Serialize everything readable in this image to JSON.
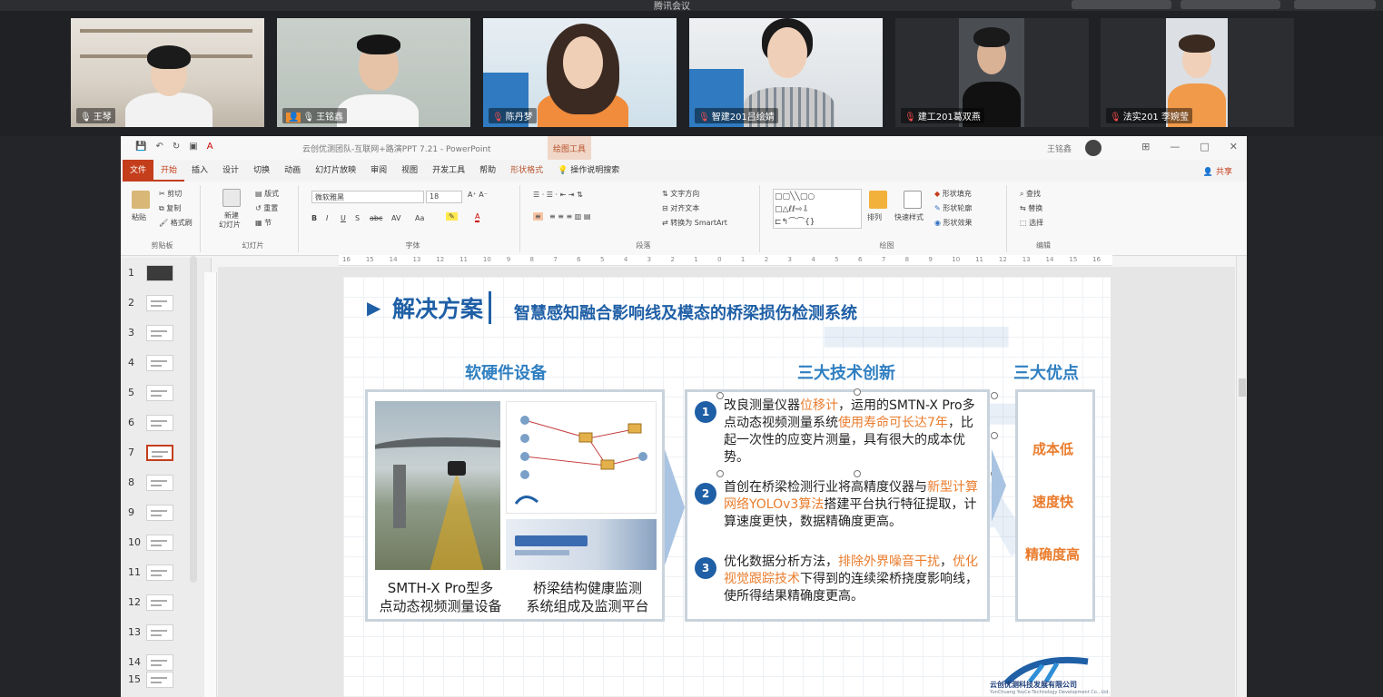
{
  "meeting": {
    "title": "腾讯会议",
    "participants": [
      {
        "name": "王琴",
        "muted": false,
        "active": false
      },
      {
        "name": "王铭鑫",
        "muted": false,
        "active": true
      },
      {
        "name": "陈丹梦",
        "muted": true,
        "active": false
      },
      {
        "name": "智建201吕绘婧",
        "muted": true,
        "active": false
      },
      {
        "name": "建工201葛双燕",
        "muted": true,
        "active": false
      },
      {
        "name": "法实201 李婉莹",
        "muted": true,
        "active": false
      }
    ]
  },
  "powerpoint": {
    "doc_title": "云创优测团队-互联网+路演PPT 7.21 - PowerPoint",
    "context_tab": "绘图工具",
    "user": "王铭鑫",
    "window_buttons": [
      "⊞",
      "—",
      "□",
      "✕"
    ],
    "tabs": [
      "文件",
      "开始",
      "插入",
      "设计",
      "切换",
      "动画",
      "幻灯片放映",
      "审阅",
      "视图",
      "开发工具",
      "帮助",
      "形状格式"
    ],
    "tell_me": "操作说明搜索",
    "share": "共享",
    "ribbon": {
      "clipboard": {
        "label": "剪贴板",
        "paste": "粘贴",
        "cut": "剪切",
        "copy": "复制",
        "format_painter": "格式刷"
      },
      "slides": {
        "label": "幻灯片",
        "new_slide": "新建",
        "new_slide_2": "幻灯片",
        "layout": "版式",
        "reset": "重置",
        "section": "节"
      },
      "font": {
        "label": "字体",
        "font_name": "微软雅黑",
        "font_size": "18",
        "buttons": [
          "B",
          "I",
          "U",
          "S",
          "abc",
          "AV",
          "Aa"
        ]
      },
      "paragraph": {
        "label": "段落",
        "text_direction": "文字方向",
        "align_text": "对齐文本",
        "smartart": "转换为 SmartArt"
      },
      "drawing": {
        "label": "绘图",
        "arrange": "排列",
        "quick_styles": "快速样式",
        "fill": "形状填充",
        "outline": "形状轮廓",
        "effects": "形状效果"
      },
      "editing": {
        "label": "编辑",
        "find": "查找",
        "replace": "替换",
        "select": "选择"
      }
    },
    "ruler_ticks": [
      "16",
      "15",
      "14",
      "13",
      "12",
      "11",
      "10",
      "9",
      "8",
      "7",
      "6",
      "5",
      "4",
      "3",
      "2",
      "1",
      "0",
      "1",
      "2",
      "3",
      "4",
      "5",
      "6",
      "7",
      "8",
      "9",
      "10",
      "11",
      "12",
      "13",
      "14",
      "15",
      "16"
    ],
    "thumbnails": [
      "1",
      "2",
      "3",
      "4",
      "5",
      "6",
      "7",
      "8",
      "9",
      "10",
      "11",
      "12",
      "13",
      "14",
      "15"
    ],
    "selected_slide": 7
  },
  "slide": {
    "title": "解决方案",
    "subtitle": "智慧感知融合影响线及模态的桥梁损伤检测系统",
    "section_hardware": "软硬件设备",
    "section_innovation": "三大技术创新",
    "section_advantages": "三大优点",
    "caption_left_1": "SMTH-X Pro型多",
    "caption_left_2": "点动态视频测量设备",
    "caption_right_1": "桥梁结构健康监测",
    "caption_right_2": "系统组成及监测平台",
    "items": [
      {
        "num": "1",
        "p1": "改良测量仪器",
        "h1": "位移计",
        "p2": "，运用的SMTN-X Pro多点动态视频测量系统",
        "h2": "使用寿命可长达7年",
        "p3": "，比起一次性的应变片测量，具有很大的成本优势。"
      },
      {
        "num": "2",
        "p1": "首创在桥梁检测行业将高精度仪器与",
        "h1": "新型计算网络YOLOv3算法",
        "p2": "搭建平台执行特征提取，计算速度更快，数据精确度更高。",
        "h2": "",
        "p3": ""
      },
      {
        "num": "3",
        "p1": "优化数据分析方法，",
        "h1": "排除外界噪音干扰",
        "p2": "，",
        "h2": "优化视觉跟踪技术",
        "p3": "下得到的连续梁桥挠度影响线，使所得结果精确度更高。"
      }
    ],
    "advantages": [
      "成本低",
      "速度快",
      "精确度高"
    ],
    "logo_text": "云创优测科技发展有限公司",
    "logo_sub": "YunChuang YouCe Technology Development Co., Ltd."
  },
  "colors": {
    "accent": "#1f5fa6",
    "highlight": "#ea7c2c",
    "ppt_red": "#c43e1c",
    "active_speaker": "#2fa85a"
  }
}
